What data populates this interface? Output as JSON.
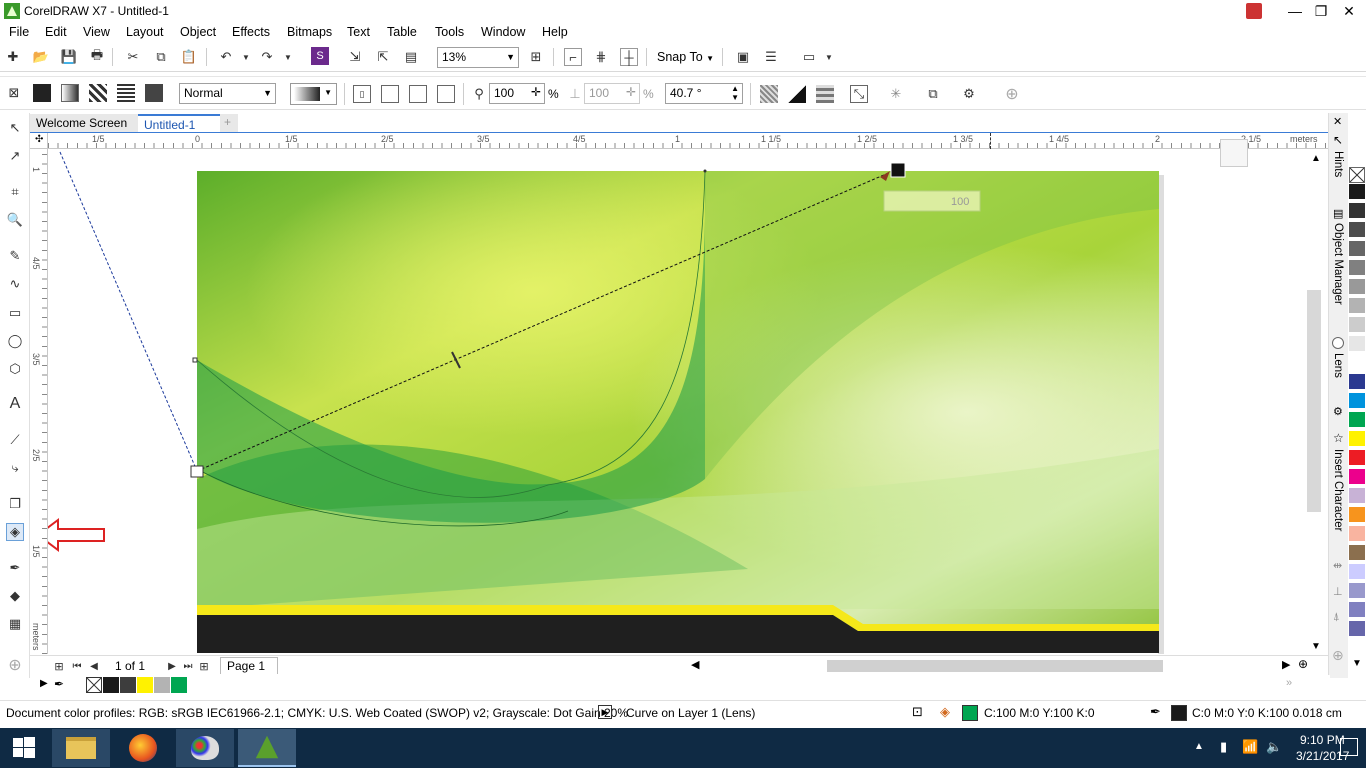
{
  "window": {
    "title": "CorelDRAW X7 - Untitled-1",
    "minimize": "—",
    "maximize": "❐",
    "close": "✕"
  },
  "menu": [
    "File",
    "Edit",
    "View",
    "Layout",
    "Object",
    "Effects",
    "Bitmaps",
    "Text",
    "Table",
    "Tools",
    "Window",
    "Help"
  ],
  "toolbar1": {
    "zoom": "13%",
    "snap_to": "Snap To"
  },
  "toolbar2": {
    "mode": "Normal",
    "opacity1": "100",
    "opacity2": "100",
    "percent": "%",
    "angle": "40.7 °"
  },
  "tabs": {
    "welcome": "Welcome Screen",
    "document": "Untitled-1",
    "add": "+"
  },
  "ruler": {
    "units": "meters",
    "h_ticks": [
      "1/5",
      "0",
      "1/5",
      "2/5",
      "3/5",
      "4/5",
      "1",
      "1 1/5",
      "1 2/5",
      "1 3/5",
      "1 4/5",
      "2",
      "2 1/5"
    ],
    "v_ticks": [
      "1",
      "4/5",
      "3/5",
      "2/5",
      "1/5"
    ],
    "v_units": "meters"
  },
  "transparency_handle": {
    "value": "100"
  },
  "page_nav": {
    "counter": "1 of 1",
    "page_tab": "Page 1"
  },
  "dockers": {
    "hints": "Hints",
    "object_manager": "Object Manager",
    "lens": "Lens",
    "insert_character": "Insert Character"
  },
  "palette_colors": [
    "#1a1a1a",
    "#333333",
    "#4d4d4d",
    "#666666",
    "#808080",
    "#999999",
    "#b3b3b3",
    "#cccccc",
    "#e6e6e6",
    "#ffffff",
    "#2b3990",
    "#0093dd",
    "#00a651",
    "#fff200",
    "#ed1c24",
    "#ec008c",
    "#c8b2d6",
    "#f7941d",
    "#f9b4a0",
    "#8b6f4e",
    "#ccccff",
    "#9999cc",
    "#8080c0",
    "#6666aa"
  ],
  "doc_palette": [
    "#1a1a1a",
    "#3d3d3d",
    "#fff200",
    "#b3b3b3",
    "#00a651"
  ],
  "status": {
    "color_profiles": "Document color profiles: RGB: sRGB IEC61966-2.1; CMYK: U.S. Web Coated (SWOP) v2; Grayscale: Dot Gain 20%",
    "object_info": "Curve on Layer 1  (Lens)",
    "fill_info": "C:100 M:0 Y:100 K:0",
    "fill_color": "#00a651",
    "outline_info": "C:0 M:0 Y:0 K:100  0.018 cm",
    "outline_color": "#1a1a1a"
  },
  "taskbar": {
    "time": "9:10 PM",
    "date": "3/21/2017"
  }
}
